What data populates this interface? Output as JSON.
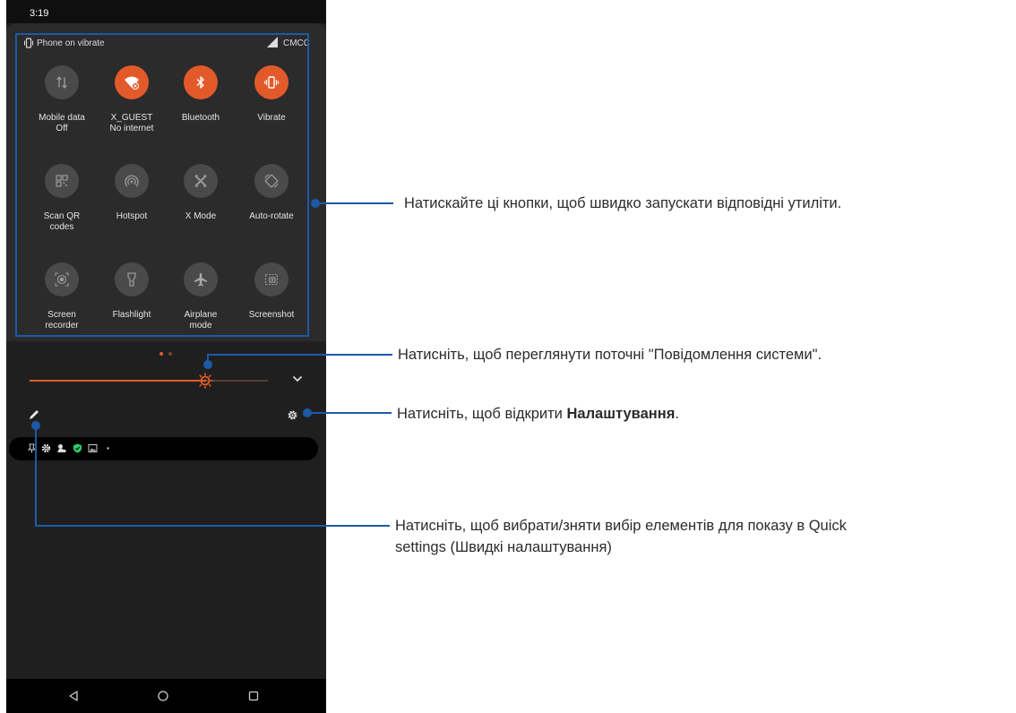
{
  "statusbar": {
    "time": "3:19"
  },
  "panel": {
    "vibrate_text": "Phone on vibrate",
    "carrier": "CMCC"
  },
  "tiles": [
    {
      "label": "Mobile data",
      "sub": "Off",
      "icon": "mobile-data-icon",
      "state": "off"
    },
    {
      "label": "X_GUEST",
      "sub": "No internet",
      "icon": "wifi-icon",
      "state": "on"
    },
    {
      "label": "Bluetooth",
      "sub": "",
      "icon": "bluetooth-icon",
      "state": "on"
    },
    {
      "label": "Vibrate",
      "sub": "",
      "icon": "vibrate-icon",
      "state": "on"
    },
    {
      "label": "Scan QR",
      "sub": "codes",
      "icon": "qr-code-icon",
      "state": "off"
    },
    {
      "label": "Hotspot",
      "sub": "",
      "icon": "hotspot-icon",
      "state": "off"
    },
    {
      "label": "X Mode",
      "sub": "",
      "icon": "x-mode-icon",
      "state": "off"
    },
    {
      "label": "Auto-rotate",
      "sub": "",
      "icon": "auto-rotate-icon",
      "state": "off"
    },
    {
      "label": "Screen",
      "sub": "recorder",
      "icon": "screen-recorder-icon",
      "state": "off"
    },
    {
      "label": "Flashlight",
      "sub": "",
      "icon": "flashlight-icon",
      "state": "off"
    },
    {
      "label": "Airplane",
      "sub": "mode",
      "icon": "airplane-icon",
      "state": "off"
    },
    {
      "label": "Screenshot",
      "sub": "",
      "icon": "screenshot-icon",
      "state": "off"
    }
  ],
  "brightness": {
    "level_fraction": 0.73
  },
  "annotations": {
    "quick_buttons": "Натискайте ці кнопки, щоб швидко запускати відповідні утиліти.",
    "notifications": "Натисніть, щоб переглянути поточні \"Повідомлення системи\".",
    "settings_prefix": "Натисніть, щоб відкрити ",
    "settings_bold": "Налаштування",
    "settings_suffix": ".",
    "edit_line1": "Натисніть, щоб вибрати/зняти вибір елементів для показу в Quick",
    "edit_line2": "settings (Швидкі налаштування)"
  },
  "colors": {
    "accent": "#e35a2a",
    "callout": "#1c5aa6",
    "panel": "#2b2b2b",
    "background": "#1f1f1f"
  }
}
